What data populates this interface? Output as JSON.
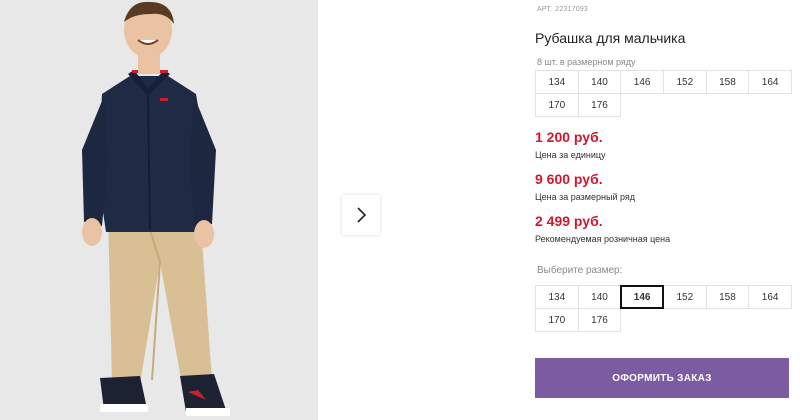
{
  "product": {
    "sku_label": "АРТ.",
    "sku_value": "22317093",
    "title": "Рубашка для мальчика",
    "pack_note": "8 шт. в размерном ряду",
    "pack_sizes": [
      "134",
      "140",
      "146",
      "152",
      "158",
      "164",
      "170",
      "176"
    ]
  },
  "prices": [
    {
      "value": "1 200 руб.",
      "caption": "Цена за единицу"
    },
    {
      "value": "9 600 руб.",
      "caption": "Цена за размерный ряд"
    },
    {
      "value": "2 499 руб.",
      "caption": "Рекомендуемая розничная цена"
    }
  ],
  "size_picker": {
    "label": "Выберите размер:",
    "options": [
      "134",
      "140",
      "146",
      "152",
      "158",
      "164",
      "170",
      "176"
    ],
    "selected": "146"
  },
  "order_button": {
    "label": "ОФОРМИТЬ ЗАКАЗ"
  },
  "gallery": {
    "next_icon": "chevron-right-icon"
  },
  "colors": {
    "price": "#d3172f",
    "accent": "#7b5ca3",
    "shirt": "#1f2a44",
    "pants": "#d9bf94"
  }
}
